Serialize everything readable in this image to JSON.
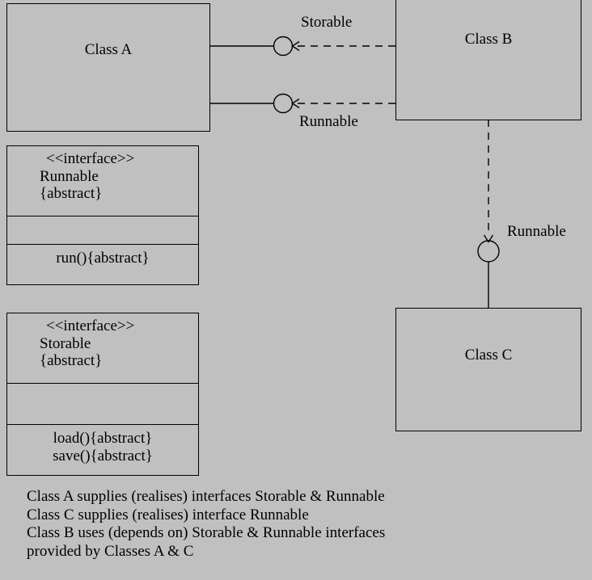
{
  "diagram": {
    "background_color": "#c0c0c0",
    "stroke_color": "#000000",
    "classes": [
      {
        "id": "class-a",
        "name": "Class A"
      },
      {
        "id": "class-b",
        "name": "Class B"
      },
      {
        "id": "class-c",
        "name": "Class C"
      }
    ],
    "interfaces": [
      {
        "id": "iface-runnable",
        "stereotype": "<<interface>>",
        "name": "Runnable",
        "abstract_marker": "{abstract}",
        "attributes": [],
        "operations": [
          "run(){abstract}"
        ]
      },
      {
        "id": "iface-storable",
        "stereotype": "<<interface>>",
        "name": "Storable",
        "abstract_marker": "{abstract}",
        "attributes": [],
        "operations": [
          "load(){abstract}",
          "save(){abstract}"
        ]
      }
    ],
    "connectors": [
      {
        "id": "lollipop-storable",
        "interface_label": "Storable",
        "provider": "Class A",
        "consumer": "Class B",
        "provided_line": "solid",
        "required_line": "dashed",
        "arrowhead": "open"
      },
      {
        "id": "lollipop-runnable-ab",
        "interface_label": "Runnable",
        "provider": "Class A",
        "consumer": "Class B",
        "provided_line": "solid",
        "required_line": "dashed",
        "arrowhead": "open"
      },
      {
        "id": "lollipop-runnable-cb",
        "interface_label": "Runnable",
        "provider": "Class C",
        "consumer": "Class B",
        "provided_line": "solid",
        "required_line": "dashed",
        "arrowhead": "open"
      }
    ],
    "caption": [
      "Class A supplies (realises) interfaces Storable & Runnable",
      "Class C supplies (realises) interface Runnable",
      "Class B uses (depends on) Storable & Runnable interfaces",
      "provided by Classes A & C"
    ]
  }
}
